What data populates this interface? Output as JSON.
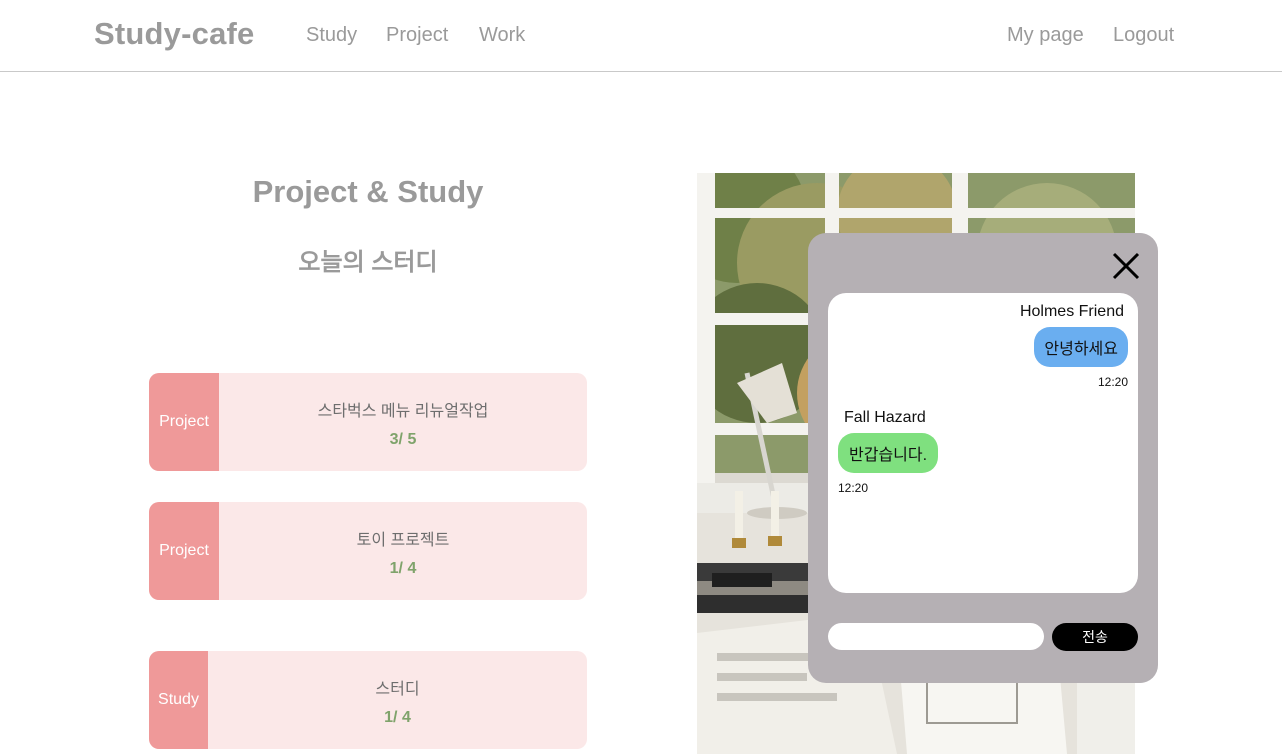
{
  "header": {
    "brand": "Study-cafe",
    "nav": [
      "Study",
      "Project",
      "Work"
    ],
    "right_nav": [
      "My page",
      "Logout"
    ]
  },
  "main": {
    "title": "Project & Study",
    "subtitle": "오늘의 스터디",
    "cards": [
      {
        "tag": "Project",
        "name": "스타벅스 메뉴 리뉴얼작업",
        "count": "3/ 5"
      },
      {
        "tag": "Project",
        "name": "토이 프로젝트",
        "count": "1/ 4"
      },
      {
        "tag": "Study",
        "name": "스터디",
        "count": "1/ 4"
      }
    ]
  },
  "chat": {
    "close_icon": "close-icon",
    "messages": [
      {
        "sender": "Holmes Friend",
        "text": "안녕하세요",
        "time": "12:20",
        "side": "right"
      },
      {
        "sender": "Fall Hazard",
        "text": "반갑습니다.",
        "time": "12:20",
        "side": "left"
      }
    ],
    "input_placeholder": "",
    "send_label": "전송"
  },
  "colors": {
    "card_bg": "#fbe8e8",
    "tag_bg": "#ef9999",
    "count": "#7fa36b",
    "chat_bg": "#b5b0b4",
    "bubble_right": "#6aaef0",
    "bubble_left": "#7fe07f"
  }
}
